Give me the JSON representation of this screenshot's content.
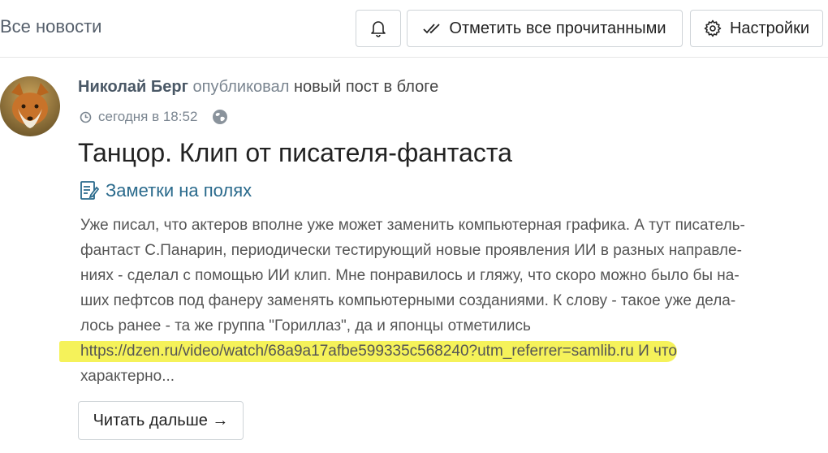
{
  "header": {
    "title": "Все новости",
    "mark_all_read_label": "Отметить все прочитанными",
    "settings_label": "Настройки"
  },
  "post": {
    "author": "Николай Берг",
    "action": "опубликовал",
    "object": "новый пост в блоге",
    "timestamp": "сегодня в 18:52",
    "title": "Танцор. Клип от писателя-фантаста",
    "blog_name": "Заметки на полях",
    "excerpt_lines": [
      "Уже писал, что актеров вполне уже может заменить компьютерная графика. А тут писатель-",
      "фантаст С.Панарин, периодически тестирующий новые проявления ИИ в разных направле-",
      "ниях - сделал с помощью ИИ клип. Мне понравилось и гляжу, что скоро можно было бы на-",
      "ших пефтсов под фанеру заменять компьютерными созданиями. К слову - такое уже дела-",
      "лось ранее - та же группа \"Гориллаз\", да и японцы отметились"
    ],
    "excerpt_link": "https://dzen.ru/video/watch/68a9a17afbe599335c568240?utm_referrer=samlib.ru",
    "excerpt_after_link": " И что",
    "excerpt_last_line": "характерно...",
    "read_more_label": "Читать дальше →"
  },
  "colors": {
    "highlight": "#f5f25a",
    "link": "#2a6a8c",
    "author": "#4a5866"
  },
  "icons": {
    "bell": "bell-icon",
    "mark_read": "double-check-icon",
    "settings": "gear-icon",
    "clock": "clock-icon",
    "globe": "globe-icon",
    "blog": "notebook-icon"
  }
}
